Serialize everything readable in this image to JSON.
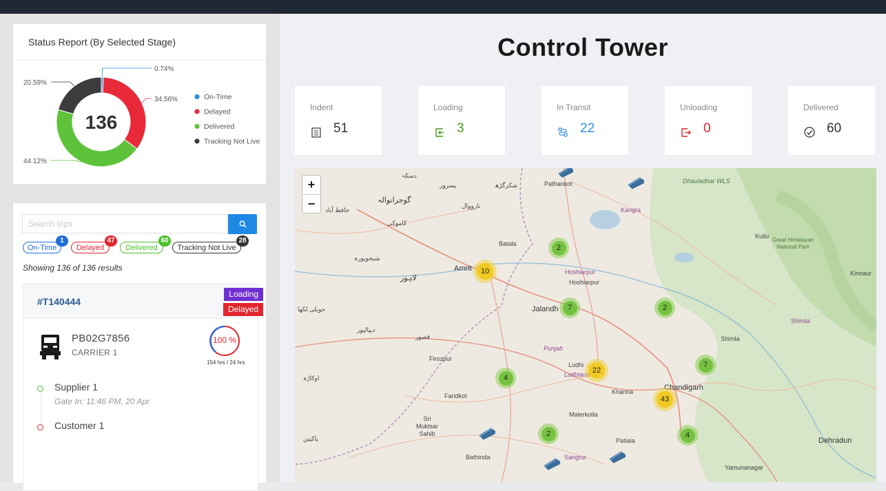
{
  "status_report": {
    "title": "Status Report (By Selected Stage)",
    "total": "136",
    "segments": [
      {
        "name": "On-Time",
        "percent": 0.74,
        "label": "0.74%",
        "color": "#2f8de4"
      },
      {
        "name": "Delayed",
        "percent": 34.56,
        "label": "34.56%",
        "color": "#e8293a"
      },
      {
        "name": "Delivered",
        "percent": 44.12,
        "label": "44.12%",
        "color": "#5ec33b"
      },
      {
        "name": "Tracking Not Live",
        "percent": 20.59,
        "label": "20.59%",
        "color": "#3c3c3c"
      }
    ]
  },
  "search": {
    "placeholder": "Search trips"
  },
  "filters": [
    {
      "label": "On-Time",
      "count": "1",
      "color": "#1e6fd9"
    },
    {
      "label": "Delayed",
      "count": "47",
      "color": "#e3262e"
    },
    {
      "label": "Delivered",
      "count": "60",
      "color": "#4cbf2a"
    },
    {
      "label": "Tracking Not Live",
      "count": "28",
      "color": "#333333"
    }
  ],
  "results_text": "Showing 136 of 136 results",
  "trip": {
    "id": "#T140444",
    "tags": [
      "Loading",
      "Delayed"
    ],
    "vehicle": "PB02G7856",
    "carrier": "CARRIER 1",
    "progress_label": "100 %",
    "progress": 100,
    "hours": "154 hrs / 24 hrs",
    "supplier": "Supplier 1",
    "gate_in": "Gate In: 11:46 PM, 20 Apr",
    "customer": "Customer 1"
  },
  "control_tower": {
    "title": "Control Tower",
    "stats": [
      {
        "label": "Indent",
        "value": "51",
        "color": "#333333",
        "icon": "list-icon"
      },
      {
        "label": "Loading",
        "value": "3",
        "color": "#4a9a1e",
        "icon": "loading-icon"
      },
      {
        "label": "In Transit",
        "value": "22",
        "color": "#2f8de4",
        "icon": "route-icon"
      },
      {
        "label": "Unloading",
        "value": "0",
        "color": "#d8232a",
        "icon": "unloading-icon"
      },
      {
        "label": "Delivered",
        "value": "60",
        "color": "#333333",
        "icon": "check-circle-icon"
      }
    ]
  },
  "map": {
    "zoom_in": "+",
    "zoom_out": "−",
    "clusters": [
      {
        "count": "2",
        "kind": "g"
      },
      {
        "count": "10",
        "kind": "y"
      },
      {
        "count": "7",
        "kind": "g"
      },
      {
        "count": "2",
        "kind": "g"
      },
      {
        "count": "7",
        "kind": "g"
      },
      {
        "count": "22",
        "kind": "y"
      },
      {
        "count": "4",
        "kind": "g"
      },
      {
        "count": "43",
        "kind": "y"
      },
      {
        "count": "2",
        "kind": "g"
      },
      {
        "count": "4",
        "kind": "g"
      }
    ],
    "places": [
      "Pathankot",
      "Dhauladhar WLS",
      "Kangra",
      "Batala",
      "Amrit",
      "Hoshiarpur",
      "Hoshiarpur",
      "Jalandh",
      "Kullu",
      "Great Himalayan National Park",
      "Kinnaur",
      "Shimla",
      "Shimla",
      "Punjab",
      "Ludhi",
      "Ludhiana",
      "Firozpur",
      "Faridkot",
      "Khanna",
      "Chandigarh",
      "Malerkotla",
      "Sri Muktsar Sahib",
      "Patiala",
      "Bathinda",
      "Sangrur",
      "Dehradun",
      "Yamunanagar",
      "گوجرانوالہ",
      "شیخوپورہ",
      "لاہور",
      "قصور",
      "اوکاڑہ",
      "پاکپتن",
      "دسکہ",
      "پسرور",
      "شکرگڑھ",
      "نارووال",
      "کاموکی",
      "حافظ آباد",
      "حویلی لکھا",
      "دیپالپور"
    ]
  }
}
